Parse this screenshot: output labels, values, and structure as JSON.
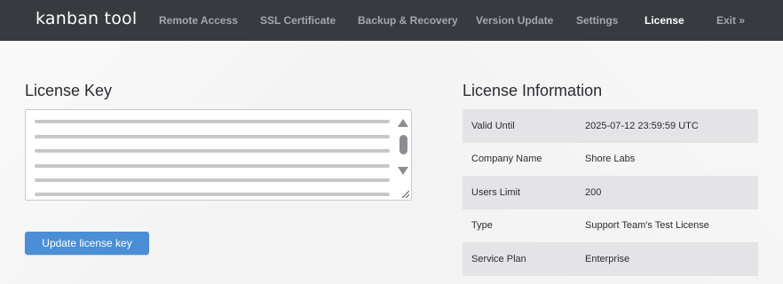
{
  "header": {
    "logo": "kanban tool",
    "nav": [
      {
        "label": "Remote Access"
      },
      {
        "label": "SSL Certificate"
      },
      {
        "label": "Backup & Recovery"
      },
      {
        "label": "Version Update"
      },
      {
        "label": "Settings"
      },
      {
        "label": "License",
        "active": true
      },
      {
        "label": "Exit »"
      }
    ]
  },
  "license_key": {
    "title": "License Key",
    "button_label": "Update license key"
  },
  "license_info": {
    "title": "License Information",
    "rows": [
      {
        "label": "Valid Until",
        "value": "2025-07-12 23:59:59 UTC"
      },
      {
        "label": "Company Name",
        "value": "Shore Labs"
      },
      {
        "label": "Users Limit",
        "value": "200"
      },
      {
        "label": "Type",
        "value": "Support Team's Test License"
      },
      {
        "label": "Service Plan",
        "value": "Enterprise"
      }
    ]
  },
  "colors": {
    "topbar": "#373a3f",
    "accent_button": "#4a8fd6",
    "row_shade": "#e4e4e6"
  }
}
